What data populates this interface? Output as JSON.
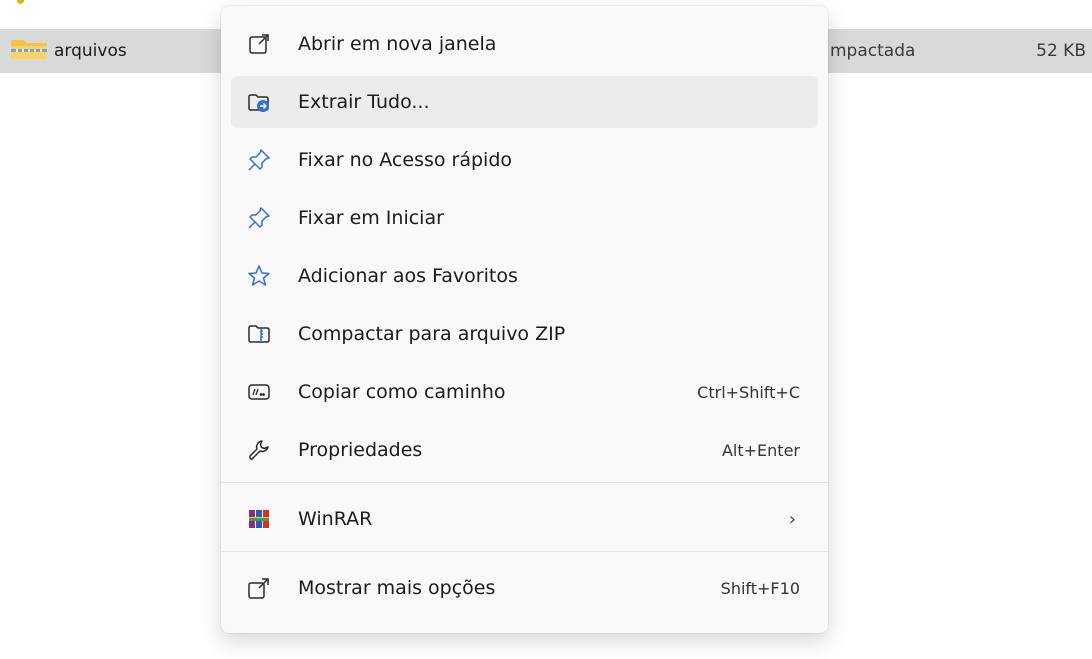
{
  "file": {
    "name": "arquivos",
    "type_fragment": "mpactada",
    "size": "52 KB"
  },
  "menu": {
    "items": [
      {
        "label": "Abrir em nova janela",
        "icon": "open-new-window-icon"
      },
      {
        "label": "Extrair Tudo...",
        "icon": "extract-all-icon"
      },
      {
        "label": "Fixar no Acesso rápido",
        "icon": "pin-icon"
      },
      {
        "label": "Fixar em Iniciar",
        "icon": "pin-icon"
      },
      {
        "label": "Adicionar aos Favoritos",
        "icon": "star-icon"
      },
      {
        "label": "Compactar para arquivo ZIP",
        "icon": "zip-folder-icon"
      },
      {
        "label": "Copiar como caminho",
        "icon": "copy-path-icon",
        "shortcut": "Ctrl+Shift+C"
      },
      {
        "label": "Propriedades",
        "icon": "wrench-icon",
        "shortcut": "Alt+Enter"
      }
    ],
    "winrar": {
      "label": "WinRAR",
      "icon": "winrar-icon"
    },
    "more": {
      "label": "Mostrar mais opções",
      "icon": "show-more-icon",
      "shortcut": "Shift+F10"
    }
  },
  "colors": {
    "accent": "#2f6fd6",
    "selected_row": "#d9d9d9",
    "menu_bg": "#f9f9f9",
    "hover_bg": "#ececec"
  }
}
